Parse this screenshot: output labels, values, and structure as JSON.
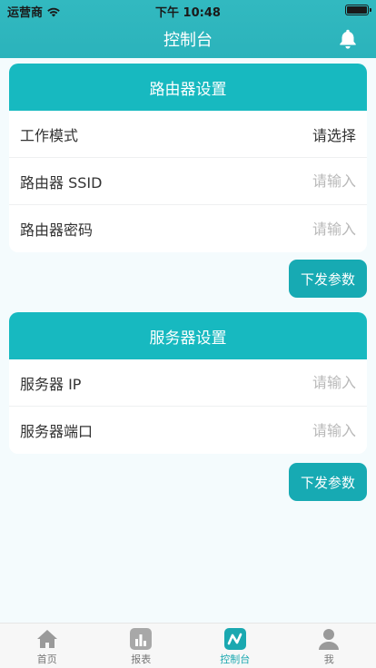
{
  "status_bar": {
    "carrier": "运营商",
    "time": "下午 10:48"
  },
  "nav": {
    "title": "控制台"
  },
  "router_section": {
    "header": "路由器设置",
    "rows": [
      {
        "label": "工作模式",
        "value": "请选择"
      },
      {
        "label": "路由器 SSID",
        "placeholder": "请输入"
      },
      {
        "label": "路由器密码",
        "placeholder": "请输入"
      }
    ],
    "button": "下发参数"
  },
  "server_section": {
    "header": "服务器设置",
    "rows": [
      {
        "label": "服务器 IP",
        "placeholder": "请输入"
      },
      {
        "label": "服务器端口",
        "placeholder": "请输入"
      }
    ],
    "button": "下发参数"
  },
  "tabbar": {
    "items": [
      {
        "label": "首页",
        "icon": "home-icon"
      },
      {
        "label": "报表",
        "icon": "chart-icon"
      },
      {
        "label": "控制台",
        "icon": "console-icon"
      },
      {
        "label": "我",
        "icon": "user-icon"
      }
    ],
    "active": "控制台"
  },
  "colors": {
    "primary": "#17b9c0",
    "button": "#17aab3",
    "nav": "#2fb7be"
  }
}
